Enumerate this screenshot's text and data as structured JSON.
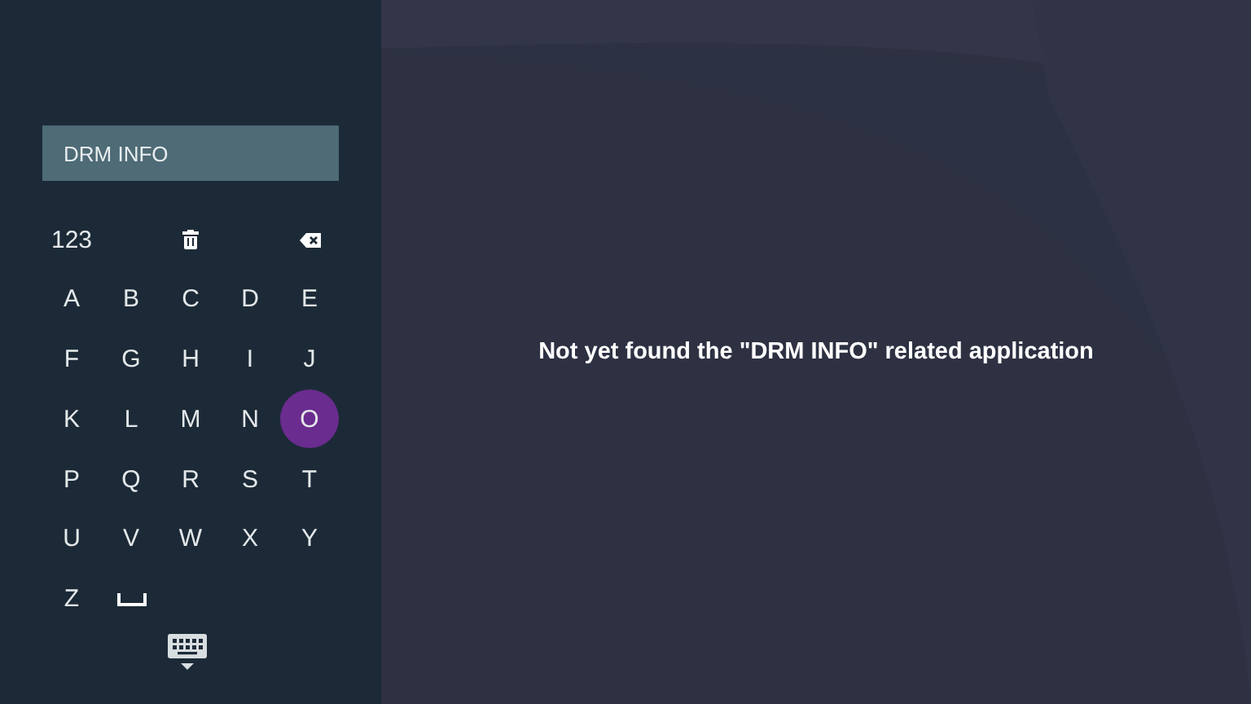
{
  "search": {
    "value": "DRM INFO"
  },
  "keys": [
    {
      "kind": "text",
      "label": "123",
      "selected": false
    },
    {
      "kind": "blank"
    },
    {
      "kind": "trash",
      "selected": false
    },
    {
      "kind": "blank"
    },
    {
      "kind": "backspace",
      "selected": false
    },
    {
      "kind": "text",
      "label": "A",
      "selected": false
    },
    {
      "kind": "text",
      "label": "B",
      "selected": false
    },
    {
      "kind": "text",
      "label": "C",
      "selected": false
    },
    {
      "kind": "text",
      "label": "D",
      "selected": false
    },
    {
      "kind": "text",
      "label": "E",
      "selected": false
    },
    {
      "kind": "text",
      "label": "F",
      "selected": false
    },
    {
      "kind": "text",
      "label": "G",
      "selected": false
    },
    {
      "kind": "text",
      "label": "H",
      "selected": false
    },
    {
      "kind": "text",
      "label": "I",
      "selected": false
    },
    {
      "kind": "text",
      "label": "J",
      "selected": false
    },
    {
      "kind": "text",
      "label": "K",
      "selected": false
    },
    {
      "kind": "text",
      "label": "L",
      "selected": false
    },
    {
      "kind": "text",
      "label": "M",
      "selected": false
    },
    {
      "kind": "text",
      "label": "N",
      "selected": false
    },
    {
      "kind": "text",
      "label": "O",
      "selected": true
    },
    {
      "kind": "text",
      "label": "P",
      "selected": false
    },
    {
      "kind": "text",
      "label": "Q",
      "selected": false
    },
    {
      "kind": "text",
      "label": "R",
      "selected": false
    },
    {
      "kind": "text",
      "label": "S",
      "selected": false
    },
    {
      "kind": "text",
      "label": "T",
      "selected": false
    },
    {
      "kind": "text",
      "label": "U",
      "selected": false
    },
    {
      "kind": "text",
      "label": "V",
      "selected": false
    },
    {
      "kind": "text",
      "label": "W",
      "selected": false
    },
    {
      "kind": "text",
      "label": "X",
      "selected": false
    },
    {
      "kind": "text",
      "label": "Y",
      "selected": false
    },
    {
      "kind": "text",
      "label": "Z",
      "selected": false
    },
    {
      "kind": "space",
      "selected": false
    }
  ],
  "message": "Not yet found the \"DRM INFO\" related application"
}
